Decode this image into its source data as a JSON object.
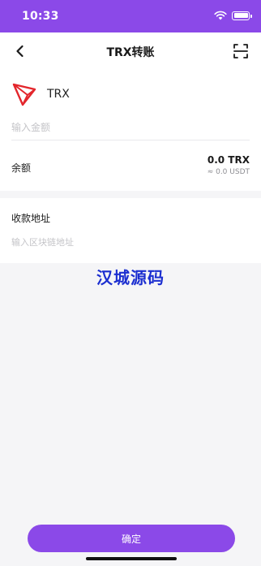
{
  "status_bar": {
    "time": "10:33",
    "icons": [
      "wifi-icon",
      "battery-icon"
    ],
    "background": "#8b49e8"
  },
  "nav": {
    "title": "TRX转账",
    "back_icon": "chevron-left-icon",
    "scan_icon": "scan-icon"
  },
  "token": {
    "symbol": "TRX",
    "logo_icon": "tron-logo-icon",
    "logo_color": "#e3262c"
  },
  "amount": {
    "placeholder": "输入金额",
    "value": ""
  },
  "balance": {
    "label": "余额",
    "value": "0.0 TRX",
    "usdt": "≈ 0.0 USDT"
  },
  "address": {
    "label": "收款地址",
    "placeholder": "输入区块链地址",
    "value": ""
  },
  "watermark": "汉城源码",
  "confirm": {
    "label": "确定"
  },
  "colors": {
    "accent": "#8b49e8",
    "watermark": "#1c2fd0",
    "page_background": "#f5f5f7"
  }
}
